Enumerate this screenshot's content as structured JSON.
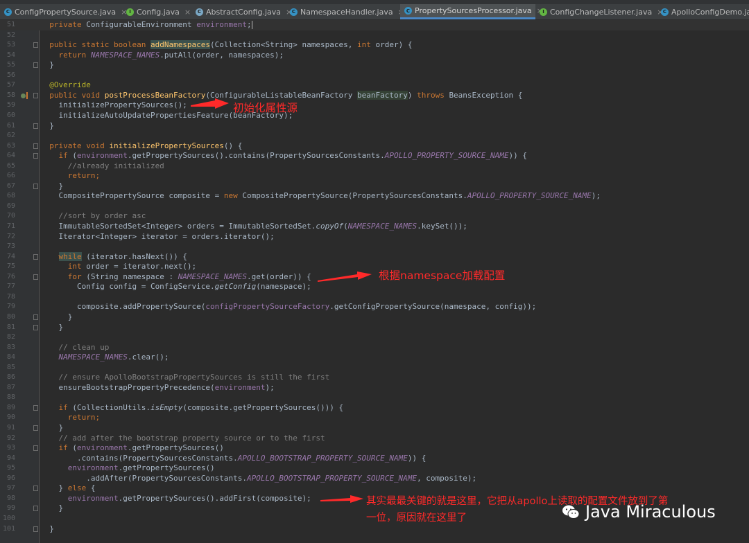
{
  "tabs": [
    {
      "label": "ConfigPropertySource.java",
      "icon": "class-icon",
      "active": false
    },
    {
      "label": "Config.java",
      "icon": "interface-icon",
      "active": false
    },
    {
      "label": "AbstractConfig.java",
      "icon": "abstract-class-icon",
      "active": false
    },
    {
      "label": "NamespaceHandler.java",
      "icon": "class-icon",
      "active": false
    },
    {
      "label": "PropertySourcesProcessor.java",
      "icon": "class-icon",
      "active": true
    },
    {
      "label": "ConfigChangeListener.java",
      "icon": "interface-icon",
      "active": false
    },
    {
      "label": "ApolloConfigDemo.java",
      "icon": "class-icon",
      "active": false
    }
  ],
  "line_numbers": [
    "51",
    "52",
    "53",
    "54",
    "55",
    "56",
    "57",
    "58",
    "59",
    "60",
    "61",
    "62",
    "63",
    "64",
    "65",
    "66",
    "67",
    "68",
    "69",
    "70",
    "71",
    "72",
    "73",
    "74",
    "75",
    "76",
    "77",
    "78",
    "79",
    "80",
    "81",
    "82",
    "83",
    "84",
    "85",
    "86",
    "87",
    "88",
    "89",
    "90",
    "91",
    "92",
    "93",
    "94",
    "95",
    "96",
    "97",
    "98",
    "99",
    "100",
    "101"
  ],
  "code": {
    "l51": "  private ConfigurableEnvironment environment;",
    "l52": "",
    "l53": "  public static boolean addNamespaces(Collection<String> namespaces, int order) {",
    "l54": "    return NAMESPACE_NAMES.putAll(order, namespaces);",
    "l55": "  }",
    "l56": "",
    "l57": "  @Override",
    "l58": "  public void postProcessBeanFactory(ConfigurableListableBeanFactory beanFactory) throws BeansException {",
    "l59": "    initializePropertySources();",
    "l60": "    initializeAutoUpdatePropertiesFeature(beanFactory);",
    "l61": "  }",
    "l62": "",
    "l63": "  private void initializePropertySources() {",
    "l64": "    if (environment.getPropertySources().contains(PropertySourcesConstants.APOLLO_PROPERTY_SOURCE_NAME)) {",
    "l65": "      //already initialized",
    "l66": "      return;",
    "l67": "    }",
    "l68": "    CompositePropertySource composite = new CompositePropertySource(PropertySourcesConstants.APOLLO_PROPERTY_SOURCE_NAME);",
    "l69": "",
    "l70": "    //sort by order asc",
    "l71": "    ImmutableSortedSet<Integer> orders = ImmutableSortedSet.copyOf(NAMESPACE_NAMES.keySet());",
    "l72": "    Iterator<Integer> iterator = orders.iterator();",
    "l73": "",
    "l74": "    while (iterator.hasNext()) {",
    "l75": "      int order = iterator.next();",
    "l76": "      for (String namespace : NAMESPACE_NAMES.get(order)) {",
    "l77": "        Config config = ConfigService.getConfig(namespace);",
    "l78": "",
    "l79": "        composite.addPropertySource(configPropertySourceFactory.getConfigPropertySource(namespace, config));",
    "l80": "      }",
    "l81": "    }",
    "l82": "",
    "l83": "    // clean up",
    "l84": "    NAMESPACE_NAMES.clear();",
    "l85": "",
    "l86": "    // ensure ApolloBootstrapPropertySources is still the first",
    "l87": "    ensureBootstrapPropertyPrecedence(environment);",
    "l88": "",
    "l89": "    if (CollectionUtils.isEmpty(composite.getPropertySources())) {",
    "l90": "      return;",
    "l91": "    }",
    "l92": "    // add after the bootstrap property source or to the first",
    "l93": "    if (environment.getPropertySources()",
    "l94": "        .contains(PropertySourcesConstants.APOLLO_BOOTSTRAP_PROPERTY_SOURCE_NAME)) {",
    "l95": "      environment.getPropertySources()",
    "l96": "          .addAfter(PropertySourcesConstants.APOLLO_BOOTSTRAP_PROPERTY_SOURCE_NAME, composite);",
    "l97": "    } else {",
    "l98": "      environment.getPropertySources().addFirst(composite);",
    "l99": "    }",
    "l100": "",
    "l101": "  }"
  },
  "annotations": {
    "a1": "初始化属性源",
    "a2": "根据namespace加载配置",
    "a3_line1": "其实最最关键的就是这里，它把从apollo上读取的配置文件放到了第",
    "a3_line2": "一位，原因就在这里了"
  },
  "watermark": {
    "text": "Java Miraculous",
    "icon": "wechat-icon"
  },
  "colors": {
    "arrow": "#ff2a2a",
    "keyword": "#cc7832",
    "method": "#ffc66d",
    "field": "#9876aa",
    "comment": "#808080",
    "annotation": "#bbb529",
    "background": "#2b2b2b"
  }
}
